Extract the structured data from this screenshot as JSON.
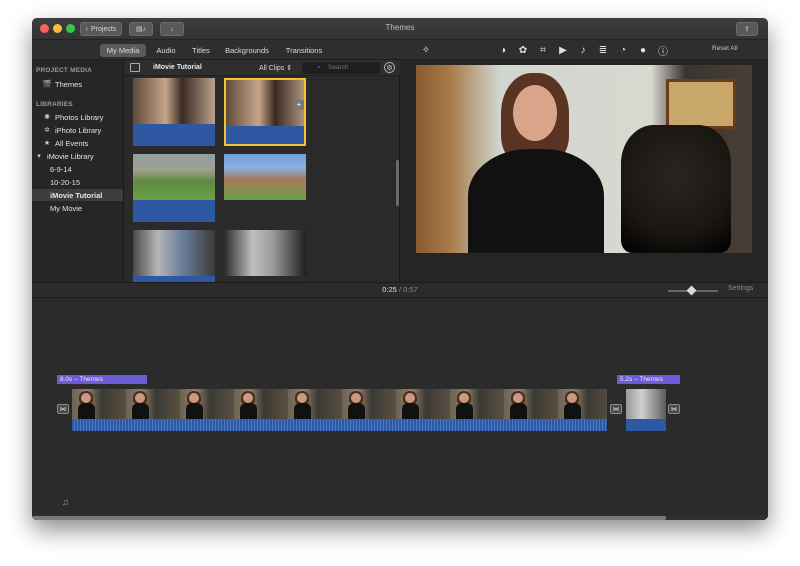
{
  "window": {
    "title": "Themes"
  },
  "titlebar": {
    "projects_label": "Projects"
  },
  "tabs": [
    {
      "label": "My Media",
      "active": true
    },
    {
      "label": "Audio",
      "active": false
    },
    {
      "label": "Titles",
      "active": false
    },
    {
      "label": "Backgrounds",
      "active": false
    },
    {
      "label": "Transitions",
      "active": false
    }
  ],
  "viewer_tools": {
    "reset_label": "Reset All"
  },
  "sidebar": {
    "project_media_heading": "PROJECT MEDIA",
    "themes_item": "Themes",
    "libraries_heading": "LIBRARIES",
    "items": [
      {
        "label": "Photos Library",
        "icon": "photos-icon"
      },
      {
        "label": "iPhoto Library",
        "icon": "iphoto-icon"
      },
      {
        "label": "All Events",
        "icon": "star-icon"
      },
      {
        "label": "iMovie Library",
        "icon": "disclosure-icon"
      },
      {
        "label": "6-9-14"
      },
      {
        "label": "10-20-15"
      },
      {
        "label": "iMovie Tutorial",
        "selected": true
      },
      {
        "label": "My Movie"
      }
    ]
  },
  "browser": {
    "title": "iMovie Tutorial",
    "filter": "All Clips",
    "search_placeholder": "Search"
  },
  "timeline": {
    "current_time": "0:25",
    "separator": "/",
    "total_time": "0:57",
    "settings_label": "Settings",
    "theme_label_1": "8.0s – Themes",
    "theme_label_2": "5.2s – Themes"
  },
  "colors": {
    "accent_yellow": "#f1c232",
    "theme_purple": "#6a5bd6",
    "audio_blue": "#2f58a3"
  }
}
